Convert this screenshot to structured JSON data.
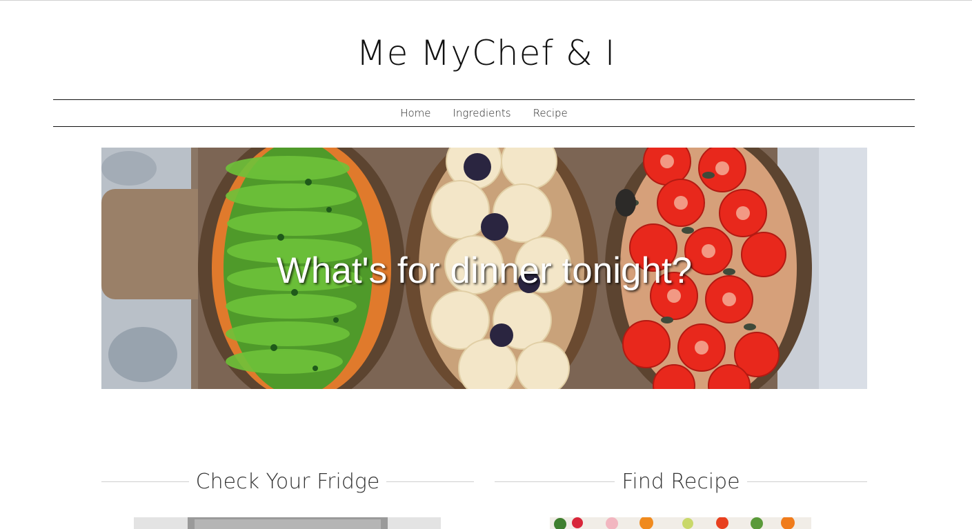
{
  "site": {
    "title": "Me MyChef & I"
  },
  "nav": {
    "items": [
      {
        "label": "Home"
      },
      {
        "label": "Ingredients"
      },
      {
        "label": "Recipe"
      }
    ]
  },
  "hero": {
    "headline": "What's for dinner tonight?",
    "image": "toast-with-avocado-banana-tomato"
  },
  "sections": [
    {
      "heading": "Check Your Fridge",
      "image": "fridge-photo"
    },
    {
      "heading": "Find Recipe",
      "image": "vegetables-photo"
    }
  ],
  "colors": {
    "text": "#111111",
    "rule": "#cfcfcf",
    "hero_text": "#ffffff"
  }
}
